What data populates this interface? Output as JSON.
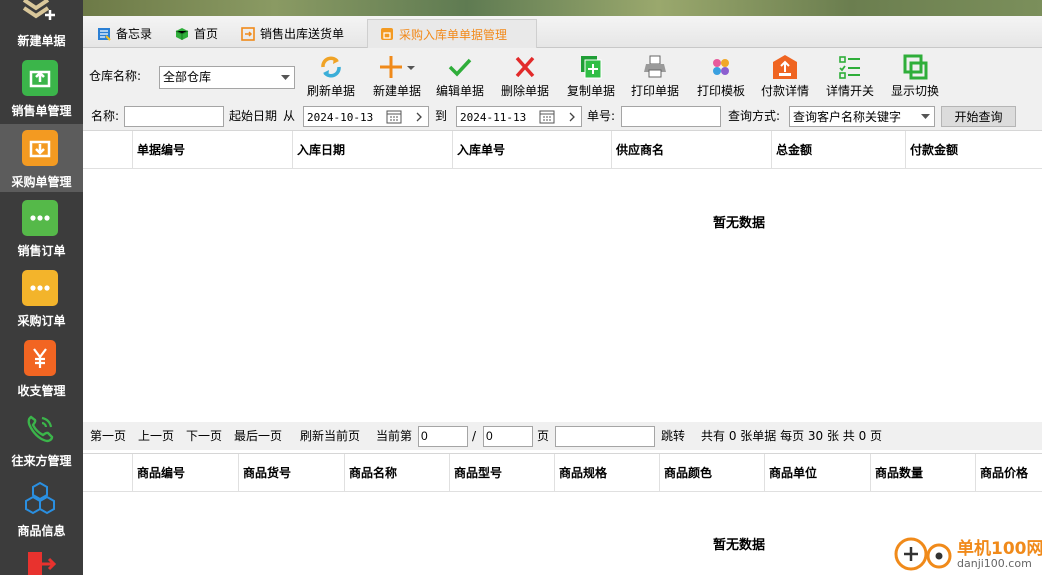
{
  "sidebar": {
    "items": [
      {
        "label": "新建单据",
        "icon": "new-doc-icon"
      },
      {
        "label": "销售单管理",
        "icon": "sales-doc-icon",
        "color": "#3bb54a"
      },
      {
        "label": "采购单管理",
        "icon": "purchase-doc-icon",
        "color": "#f39a21"
      },
      {
        "label": "销售订单",
        "icon": "sales-order-icon",
        "color": "#55b949"
      },
      {
        "label": "采购订单",
        "icon": "purchase-order-icon",
        "color": "#f3b42b"
      },
      {
        "label": "收支管理",
        "icon": "yuan-icon",
        "color": "#f26522"
      },
      {
        "label": "往来方管理",
        "icon": "phone-icon",
        "color": "#3bb54a"
      },
      {
        "label": "商品信息",
        "icon": "cubes-icon",
        "color": "#2a8fe0"
      },
      {
        "label": "",
        "icon": "exit-icon",
        "color": "#e8322e"
      }
    ]
  },
  "tabs": [
    {
      "label": "备忘录",
      "icon": "memo-icon"
    },
    {
      "label": "首页",
      "icon": "home-cube-icon"
    },
    {
      "label": "销售出库送货单",
      "icon": "outbound-icon"
    },
    {
      "label": "采购入库单单据管理",
      "icon": "inbound-icon"
    }
  ],
  "toolbar": {
    "warehouse_label": "仓库名称:",
    "warehouse_value": "全部仓库",
    "buttons": [
      {
        "label": "刷新单据",
        "icon": "refresh-icon"
      },
      {
        "label": "新建单据",
        "icon": "plus-icon"
      },
      {
        "label": "编辑单据",
        "icon": "check-icon"
      },
      {
        "label": "删除单据",
        "icon": "delete-x-icon"
      },
      {
        "label": "复制单据",
        "icon": "copy-icon"
      },
      {
        "label": "打印单据",
        "icon": "printer-icon"
      },
      {
        "label": "打印模板",
        "icon": "palette-icon"
      },
      {
        "label": "付款详情",
        "icon": "payment-icon"
      },
      {
        "label": "详情开关",
        "icon": "details-list-icon"
      },
      {
        "label": "显示切换",
        "icon": "display-switch-icon"
      }
    ]
  },
  "search": {
    "name_label": "名称:",
    "name_value": "",
    "start_date_label": "起始日期",
    "from_label": "从",
    "start_date": "2024-10-13",
    "to_label": "到",
    "end_date": "2024-11-13",
    "doc_no_label": "单号:",
    "doc_no_value": "",
    "mode_label": "查询方式:",
    "mode_value": "查询客户名称关键字",
    "search_button": "开始查询"
  },
  "main_grid": {
    "columns": [
      "单据编号",
      "入库日期",
      "入库单号",
      "供应商名",
      "总金额",
      "付款金额"
    ],
    "empty_text": "暂无数据"
  },
  "pager": {
    "first": "第一页",
    "prev": "上一页",
    "next": "下一页",
    "last": "最后一页",
    "refresh": "刷新当前页",
    "current_label": "当前第",
    "current_page": "0",
    "slash": "/",
    "total_pages": "0",
    "page_unit": "页",
    "jump_value": "",
    "jump_label": "跳转",
    "summary": "共有 0 张单据 每页 30 张 共 0 页"
  },
  "detail_grid": {
    "columns": [
      "商品编号",
      "商品货号",
      "商品名称",
      "商品型号",
      "商品规格",
      "商品颜色",
      "商品单位",
      "商品数量",
      "商品价格"
    ],
    "empty_text": "暂无数据"
  },
  "watermark": {
    "name": "单机100网",
    "url": "danji100.com"
  }
}
